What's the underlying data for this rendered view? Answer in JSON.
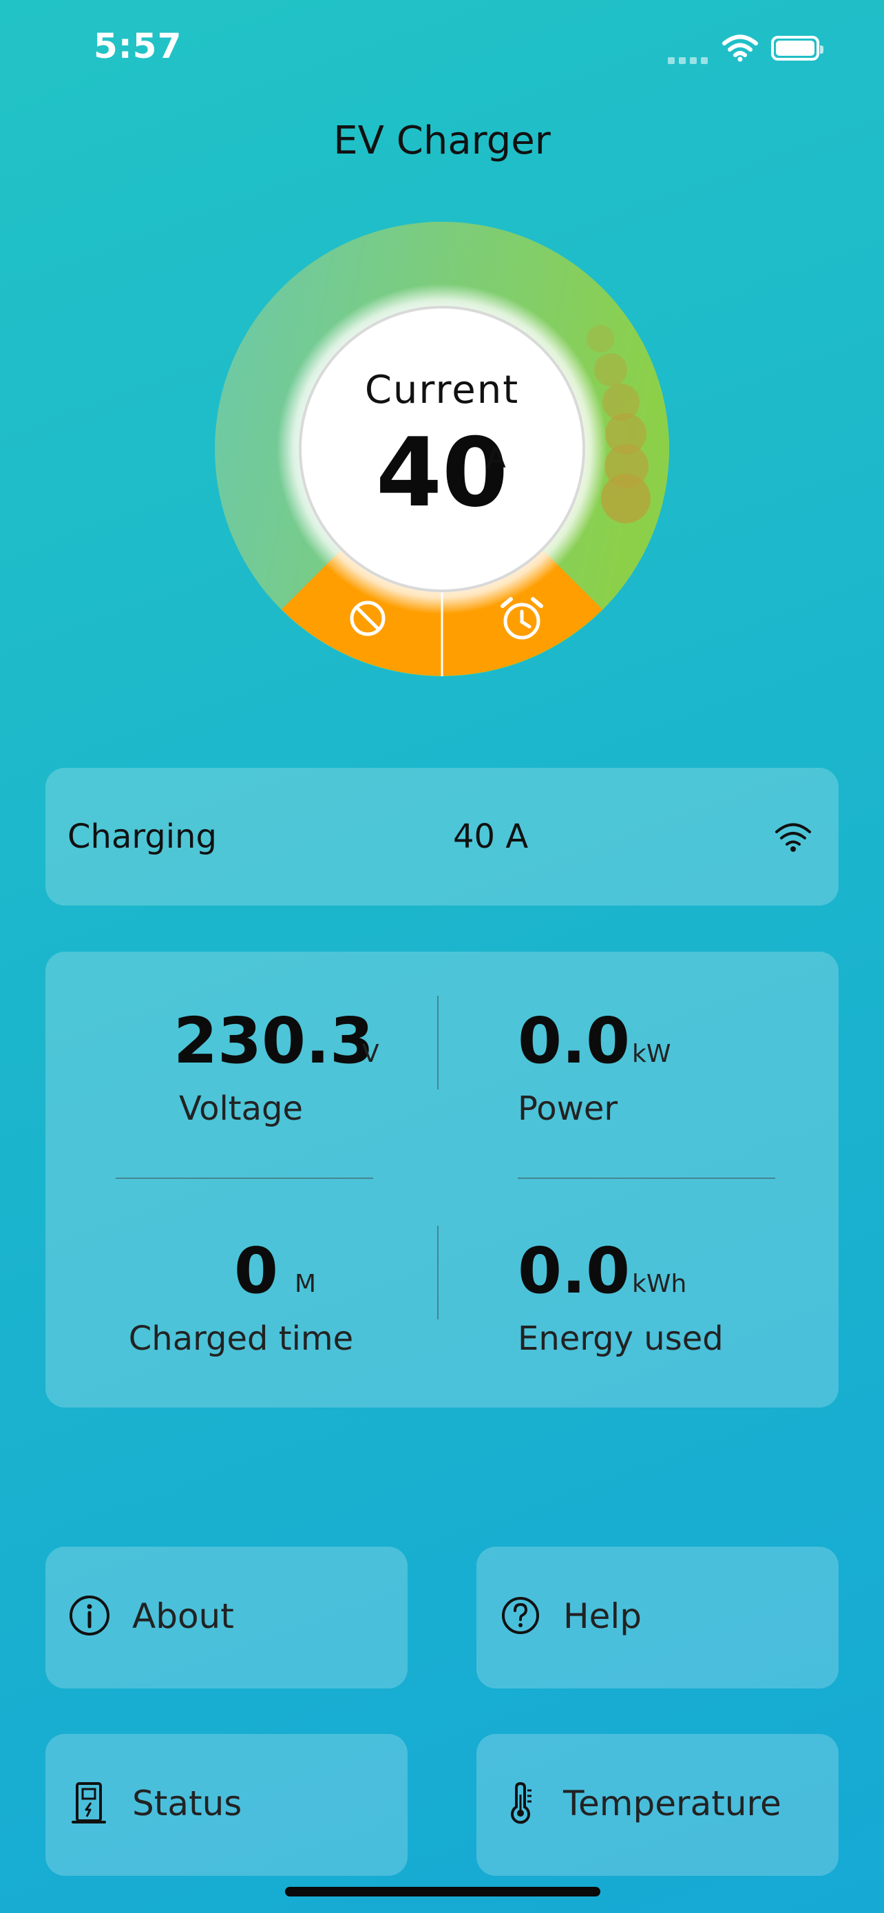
{
  "status_bar": {
    "time": "5:57"
  },
  "app": {
    "title": "EV Charger"
  },
  "gauge": {
    "label": "Current",
    "value": "40",
    "unit": "A",
    "colors": {
      "ring_start": "#6cc9ac",
      "ring_end": "#8cd04a",
      "bottom": "#ff9e00",
      "bubbles": "#b8a23a"
    },
    "actions": [
      {
        "icon": "stop-icon"
      },
      {
        "icon": "alarm-clock-icon"
      }
    ]
  },
  "status": {
    "label": "Charging",
    "value": "40 A",
    "icon": "wifi-icon"
  },
  "metrics": {
    "voltage": {
      "value": "230.3",
      "unit": "V",
      "label": "Voltage"
    },
    "power": {
      "value": "0.0",
      "unit": "kW",
      "label": "Power"
    },
    "charged_time": {
      "value": "0",
      "unit": "M",
      "label": "Charged time"
    },
    "energy_used": {
      "value": "0.0",
      "unit": "kWh",
      "label": "Energy used"
    }
  },
  "menu": {
    "about": {
      "label": "About",
      "icon": "info-icon"
    },
    "help": {
      "label": "Help",
      "icon": "question-icon"
    },
    "status": {
      "label": "Status",
      "icon": "charger-station-icon"
    },
    "temperature": {
      "label": "Temperature",
      "icon": "thermometer-icon"
    }
  }
}
